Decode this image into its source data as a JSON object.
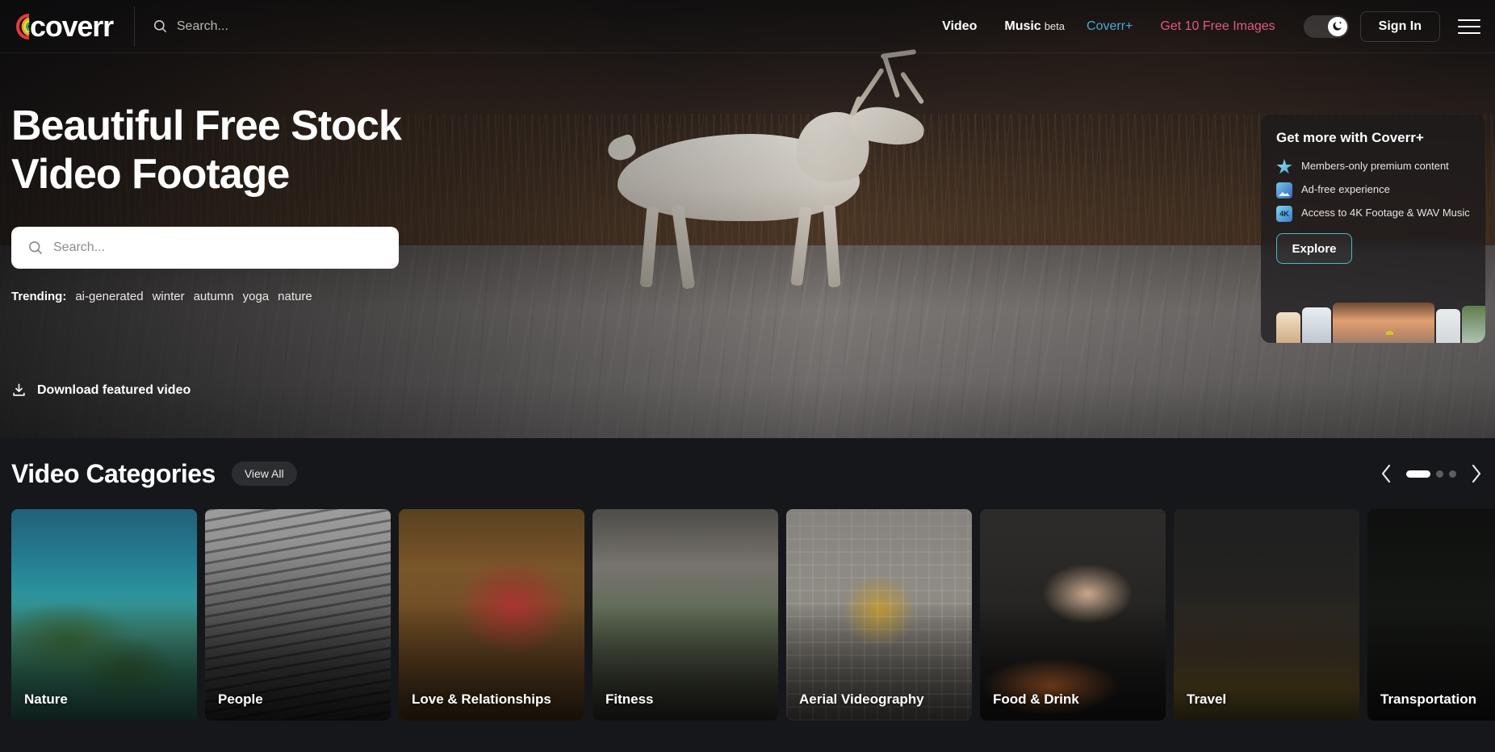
{
  "brand": {
    "name": "coverr",
    "logo_icon": "coverr-rainbow-logo"
  },
  "navbar": {
    "search_placeholder": "Search...",
    "search_icon": "search-icon",
    "links": [
      {
        "label": "Video",
        "style": "bold"
      },
      {
        "label": "Music",
        "style": "bold",
        "badge": "beta"
      },
      {
        "label": "Coverr+",
        "style": "cyan"
      },
      {
        "label": "Get 10 Free Images",
        "style": "pink"
      }
    ],
    "music_badge": "beta",
    "theme_toggle_icon": "moon-star-icon",
    "signin_label": "Sign In",
    "menu_icon": "hamburger-menu-icon"
  },
  "hero": {
    "title_line1": "Beautiful Free Stock",
    "title_line2": "Video Footage",
    "search_placeholder": "Search...",
    "search_icon": "search-icon",
    "trending_label": "Trending:",
    "trending_tags": [
      "ai-generated",
      "winter",
      "autumn",
      "yoga",
      "nature"
    ],
    "download_icon": "download-icon",
    "download_label": "Download featured video"
  },
  "coverr_plus": {
    "title": "Get more with Coverr+",
    "features": [
      {
        "icon": "premium-star-icon",
        "text": "Members-only premium content"
      },
      {
        "icon": "ad-free-icon",
        "text": "Ad-free experience"
      },
      {
        "icon": "4k-badge-icon",
        "text": "Access to 4K Footage & WAV Music"
      }
    ],
    "explore_label": "Explore",
    "accent_color": "#44bcc4"
  },
  "categories": {
    "title": "Video Categories",
    "view_all_label": "View All",
    "prev_icon": "chevron-left-icon",
    "next_icon": "chevron-right-icon",
    "pagination": {
      "total": 3,
      "active": 1
    },
    "cards": [
      {
        "label": "Nature",
        "art": "img-nature"
      },
      {
        "label": "People",
        "art": "img-people"
      },
      {
        "label": "Love & Relationships",
        "art": "img-love"
      },
      {
        "label": "Fitness",
        "art": "img-fitness"
      },
      {
        "label": "Aerial Videography",
        "art": "img-aerial"
      },
      {
        "label": "Food & Drink",
        "art": "img-food"
      },
      {
        "label": "Travel",
        "art": "img-travel"
      },
      {
        "label": "Transportation",
        "art": "img-transport"
      }
    ]
  }
}
